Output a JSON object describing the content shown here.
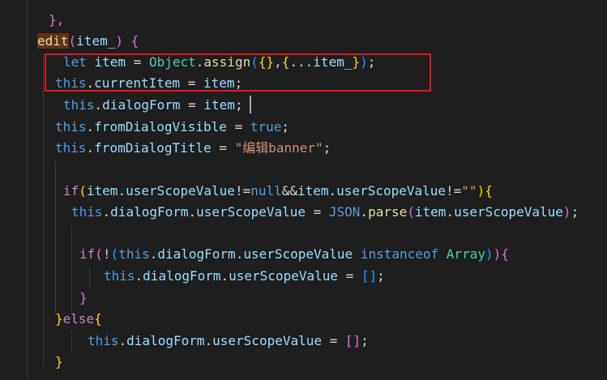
{
  "editor": {
    "lines": [
      {
        "id": "l1",
        "tokens": [
          {
            "t": "},",
            "c": "b2"
          }
        ]
      },
      {
        "id": "l2",
        "tokens": [
          {
            "t": "edit",
            "c": "fn hl-name"
          },
          {
            "t": "(",
            "c": "b2"
          },
          {
            "t": "item_",
            "c": "ident"
          },
          {
            "t": ") ",
            "c": "b2"
          },
          {
            "t": "{",
            "c": "b2"
          }
        ]
      },
      {
        "id": "l3",
        "tokens": [
          {
            "t": "let ",
            "c": "kw"
          },
          {
            "t": "item ",
            "c": "ident"
          },
          {
            "t": "= ",
            "c": "op"
          },
          {
            "t": "Object",
            "c": "cls"
          },
          {
            "t": ".",
            "c": "punc"
          },
          {
            "t": "assign",
            "c": "fn"
          },
          {
            "t": "(",
            "c": "b3"
          },
          {
            "t": "{}",
            "c": "b1"
          },
          {
            "t": ",",
            "c": "punc"
          },
          {
            "t": "{",
            "c": "b1"
          },
          {
            "t": "...",
            "c": "op"
          },
          {
            "t": "item_",
            "c": "ident"
          },
          {
            "t": "}",
            "c": "b1"
          },
          {
            "t": ")",
            "c": "b3"
          },
          {
            "t": ";",
            "c": "punc"
          }
        ]
      },
      {
        "id": "l4",
        "tokens": [
          {
            "t": "this",
            "c": "kw"
          },
          {
            "t": ".",
            "c": "punc"
          },
          {
            "t": "currentItem ",
            "c": "ident"
          },
          {
            "t": "= ",
            "c": "op"
          },
          {
            "t": "item",
            "c": "ident"
          },
          {
            "t": ";",
            "c": "punc"
          }
        ]
      },
      {
        "id": "l5",
        "tokens": [
          {
            "t": "this",
            "c": "kw"
          },
          {
            "t": ".",
            "c": "punc"
          },
          {
            "t": "dialogForm ",
            "c": "ident"
          },
          {
            "t": "= ",
            "c": "op"
          },
          {
            "t": "item",
            "c": "ident"
          },
          {
            "t": ";",
            "c": "punc"
          }
        ]
      },
      {
        "id": "l6",
        "tokens": [
          {
            "t": "this",
            "c": "kw"
          },
          {
            "t": ".",
            "c": "punc"
          },
          {
            "t": "fromDialogVisible ",
            "c": "ident"
          },
          {
            "t": "= ",
            "c": "op"
          },
          {
            "t": "true",
            "c": "kw"
          },
          {
            "t": ";",
            "c": "punc"
          }
        ]
      },
      {
        "id": "l7",
        "tokens": [
          {
            "t": "this",
            "c": "kw"
          },
          {
            "t": ".",
            "c": "punc"
          },
          {
            "t": "fromDialogTitle ",
            "c": "ident"
          },
          {
            "t": "= ",
            "c": "op"
          },
          {
            "t": "\"编辑banner\"",
            "c": "str"
          },
          {
            "t": ";",
            "c": "punc"
          }
        ]
      },
      {
        "id": "l8",
        "tokens": []
      },
      {
        "id": "l9",
        "tokens": [
          {
            "t": "if",
            "c": "kw-ctrl"
          },
          {
            "t": "(",
            "c": "b1"
          },
          {
            "t": "item",
            "c": "ident"
          },
          {
            "t": ".",
            "c": "punc"
          },
          {
            "t": "userScopeValue",
            "c": "ident"
          },
          {
            "t": "!=",
            "c": "op"
          },
          {
            "t": "null",
            "c": "kw"
          },
          {
            "t": "&&",
            "c": "op"
          },
          {
            "t": "item",
            "c": "ident"
          },
          {
            "t": ".",
            "c": "punc"
          },
          {
            "t": "userScopeValue",
            "c": "ident"
          },
          {
            "t": "!=",
            "c": "op"
          },
          {
            "t": "\"\"",
            "c": "str"
          },
          {
            "t": ")",
            "c": "b1"
          },
          {
            "t": "{",
            "c": "b1"
          }
        ]
      },
      {
        "id": "l10",
        "tokens": [
          {
            "t": "this",
            "c": "kw"
          },
          {
            "t": ".",
            "c": "punc"
          },
          {
            "t": "dialogForm",
            "c": "ident"
          },
          {
            "t": ".",
            "c": "punc"
          },
          {
            "t": "userScopeValue ",
            "c": "ident"
          },
          {
            "t": "= ",
            "c": "op"
          },
          {
            "t": "JSON",
            "c": "kw"
          },
          {
            "t": ".",
            "c": "punc"
          },
          {
            "t": "parse",
            "c": "fn"
          },
          {
            "t": "(",
            "c": "b2"
          },
          {
            "t": "item",
            "c": "ident"
          },
          {
            "t": ".",
            "c": "punc"
          },
          {
            "t": "userScopeValue",
            "c": "ident"
          },
          {
            "t": ")",
            "c": "b2"
          },
          {
            "t": ";",
            "c": "punc"
          }
        ]
      },
      {
        "id": "l11",
        "tokens": []
      },
      {
        "id": "l12",
        "tokens": [
          {
            "t": "if",
            "c": "kw-ctrl"
          },
          {
            "t": "(",
            "c": "b2"
          },
          {
            "t": "!",
            "c": "op"
          },
          {
            "t": "(",
            "c": "b3"
          },
          {
            "t": "this",
            "c": "kw"
          },
          {
            "t": ".",
            "c": "punc"
          },
          {
            "t": "dialogForm",
            "c": "ident"
          },
          {
            "t": ".",
            "c": "punc"
          },
          {
            "t": "userScopeValue ",
            "c": "ident"
          },
          {
            "t": "instanceof ",
            "c": "kw"
          },
          {
            "t": "Array",
            "c": "cls"
          },
          {
            "t": ")",
            "c": "b3"
          },
          {
            "t": ")",
            "c": "b2"
          },
          {
            "t": "{",
            "c": "b2"
          }
        ]
      },
      {
        "id": "l13",
        "tokens": [
          {
            "t": "this",
            "c": "kw"
          },
          {
            "t": ".",
            "c": "punc"
          },
          {
            "t": "dialogForm",
            "c": "ident"
          },
          {
            "t": ".",
            "c": "punc"
          },
          {
            "t": "userScopeValue ",
            "c": "ident"
          },
          {
            "t": "= ",
            "c": "op"
          },
          {
            "t": "[]",
            "c": "b3"
          },
          {
            "t": ";",
            "c": "punc"
          }
        ]
      },
      {
        "id": "l14",
        "tokens": [
          {
            "t": "}",
            "c": "b2"
          }
        ]
      },
      {
        "id": "l15",
        "tokens": [
          {
            "t": "}",
            "c": "b1"
          },
          {
            "t": "else",
            "c": "kw-ctrl"
          },
          {
            "t": "{",
            "c": "b1"
          }
        ]
      },
      {
        "id": "l16",
        "tokens": [
          {
            "t": "this",
            "c": "kw"
          },
          {
            "t": ".",
            "c": "punc"
          },
          {
            "t": "dialogForm",
            "c": "ident"
          },
          {
            "t": ".",
            "c": "punc"
          },
          {
            "t": "userScopeValue ",
            "c": "ident"
          },
          {
            "t": "= ",
            "c": "op"
          },
          {
            "t": "[]",
            "c": "b2"
          },
          {
            "t": ";",
            "c": "punc"
          }
        ]
      },
      {
        "id": "l17",
        "tokens": [
          {
            "t": "}",
            "c": "b1"
          }
        ]
      }
    ]
  },
  "colors": {
    "background": "#1e1e1e",
    "keyword": "#569cd6",
    "control_keyword": "#c586c0",
    "identifier": "#9cdcfe",
    "function": "#dcdcaa",
    "class": "#4ec9b0",
    "string": "#ce9178",
    "bracket_gold": "#ffd700",
    "bracket_orchid": "#da70d6",
    "bracket_blue": "#179fff",
    "highlight_box": "#e81123"
  }
}
